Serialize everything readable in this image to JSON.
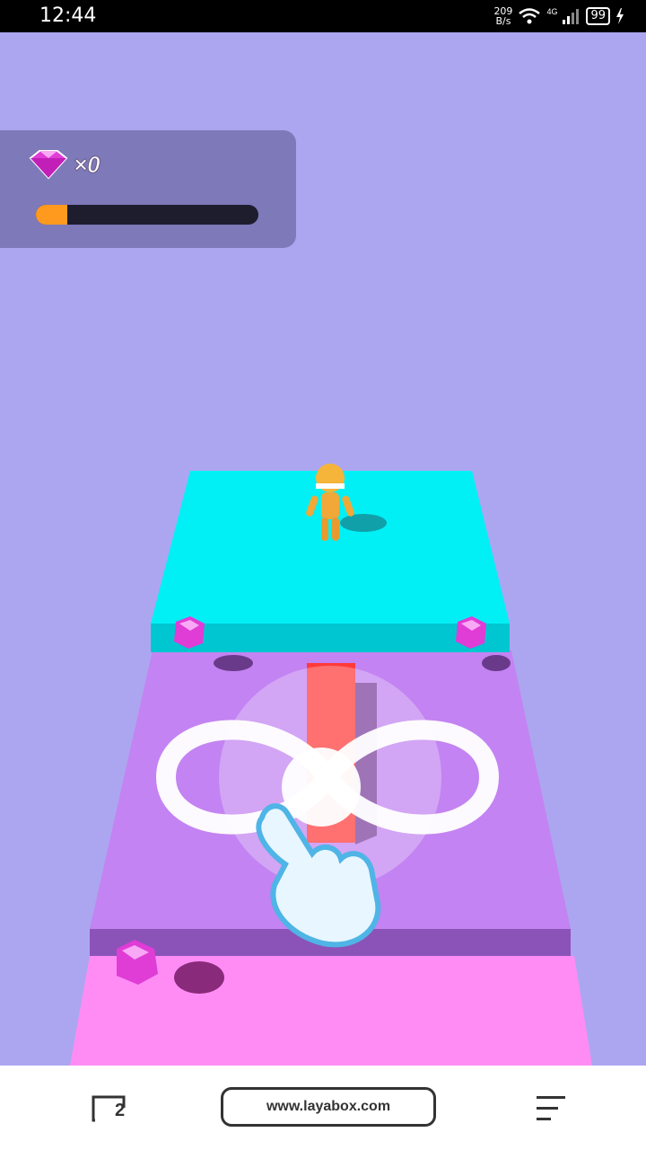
{
  "status_bar": {
    "time": "12:44",
    "net_speed_value": "209",
    "net_speed_unit": "B/s",
    "network_type": "4G",
    "battery": "99"
  },
  "hud": {
    "gem_icon": "gem-icon",
    "gem_count": "×0",
    "progress_fraction": 0.14
  },
  "tutorial": {
    "gesture": "infinity-swipe",
    "icon": "pointing-hand-icon"
  },
  "browser": {
    "tab_count": "2",
    "url": "www.layabox.com",
    "menu_icon": "menu-icon"
  },
  "colors": {
    "background": "#aca6f0",
    "top_platform": "#00f0f5",
    "middle_platform": "#c383f2",
    "bottom_platform": "#ff8cf5",
    "gem": "#e03cd6",
    "progress": "#ff9a1f"
  }
}
